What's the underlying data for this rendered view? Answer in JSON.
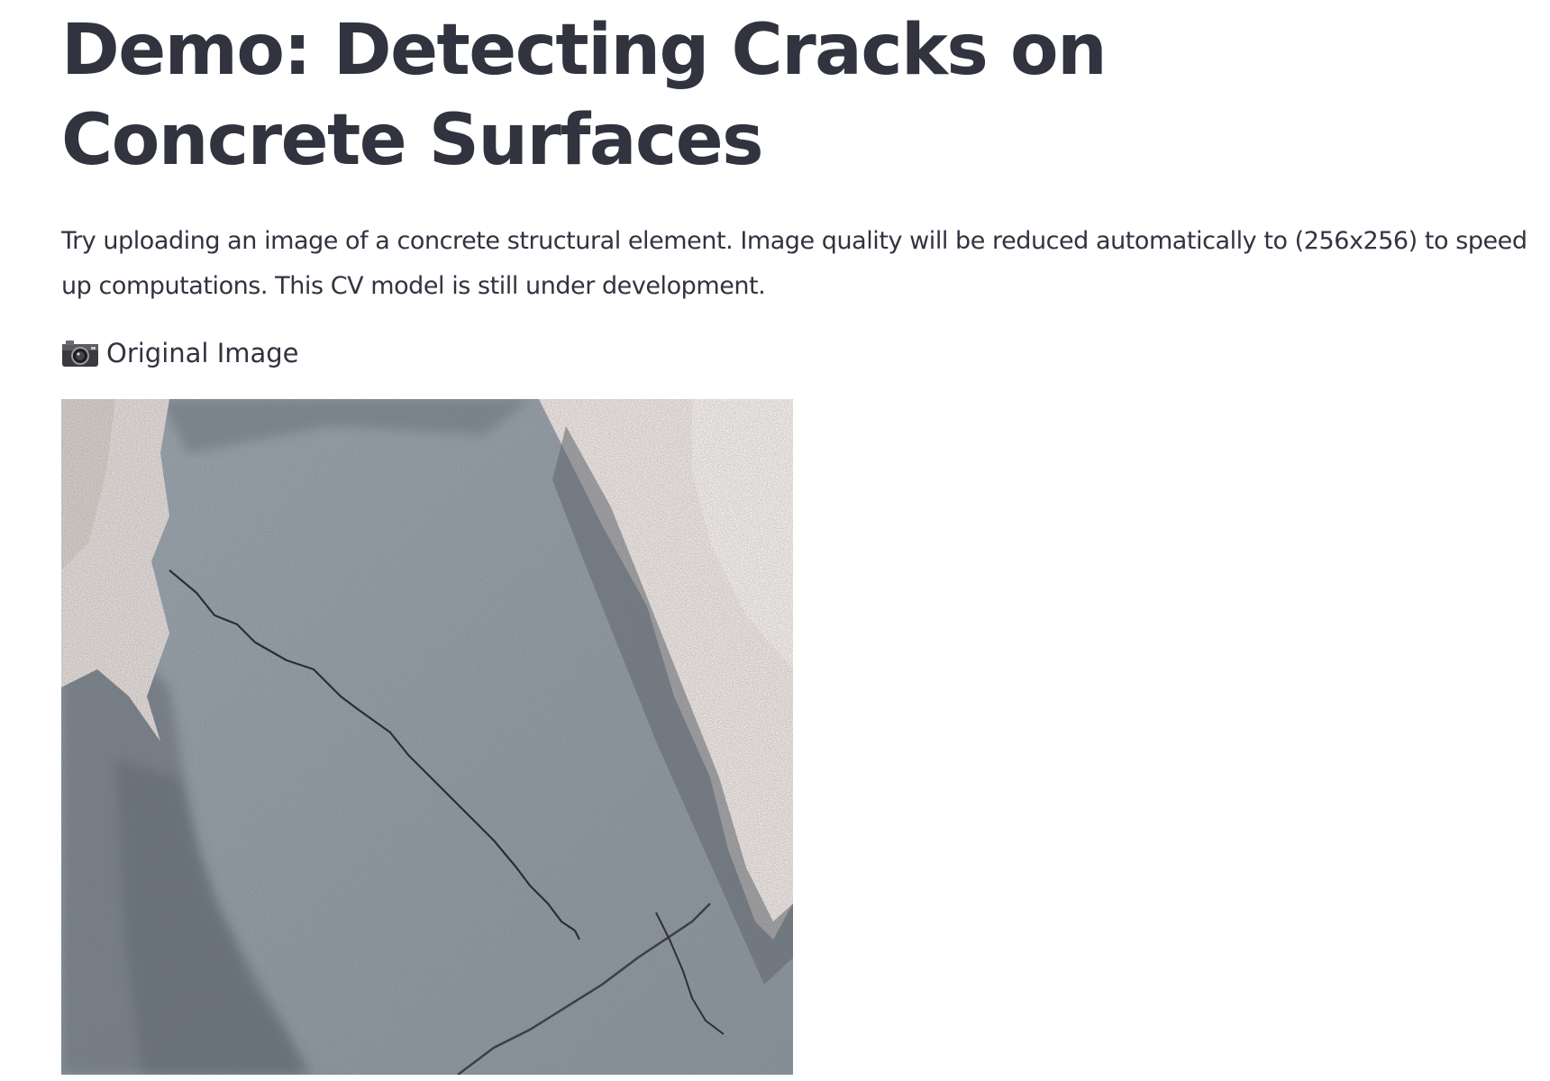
{
  "page": {
    "title": "Demo: Detecting Cracks on Concrete Surfaces",
    "intro": "Try uploading an image of a concrete structural element. Image quality will be reduced automatically to (256x256) to speed up computations. This CV model is still under development."
  },
  "original_image": {
    "caption": "Original Image",
    "icon": "camera-icon"
  }
}
